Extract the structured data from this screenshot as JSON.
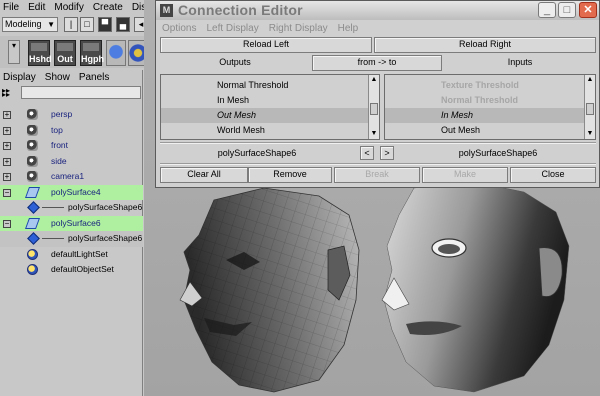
{
  "main_menu": [
    "File",
    "Edit",
    "Modify",
    "Create",
    "Displ"
  ],
  "mode_select": {
    "value": "Modeling"
  },
  "shelf_buttons": [
    "Hshd",
    "Out",
    "Hgph"
  ],
  "outliner": {
    "menu": [
      "Display",
      "Show",
      "Panels"
    ],
    "items": [
      {
        "label": "persp",
        "expand": "+"
      },
      {
        "label": "top",
        "expand": "+"
      },
      {
        "label": "front",
        "expand": "+"
      },
      {
        "label": "side",
        "expand": "+"
      },
      {
        "label": "camera1",
        "expand": "+"
      },
      {
        "label": "polySurface4",
        "expand": "−"
      },
      {
        "label": "polySurfaceShape6"
      },
      {
        "label": "polySurface6",
        "expand": "−"
      },
      {
        "label": "polySurfaceShape6"
      },
      {
        "label": "defaultLightSet"
      },
      {
        "label": "defaultObjectSet"
      }
    ]
  },
  "connection_editor": {
    "title": "Connection Editor",
    "menu": [
      "Options",
      "Left Display",
      "Right Display",
      "Help"
    ],
    "reload_left": "Reload Left",
    "reload_right": "Reload Right",
    "outputs": "Outputs",
    "direction": "from -> to",
    "inputs": "Inputs",
    "left_list": [
      "Normal Threshold",
      "In Mesh",
      "Out Mesh",
      "World Mesh"
    ],
    "right_list": [
      "Texture Threshold",
      "Normal Threshold",
      "In Mesh",
      "Out Mesh"
    ],
    "left_node": "polySurfaceShape6",
    "right_node": "polySurfaceShape6",
    "prev": "<",
    "next": ">",
    "buttons": {
      "clear_all": "Clear All",
      "remove": "Remove",
      "break": "Break",
      "make": "Make",
      "close": "Close"
    }
  },
  "window_buttons": {
    "minimize": "_",
    "maximize": "□",
    "close": "✕"
  }
}
